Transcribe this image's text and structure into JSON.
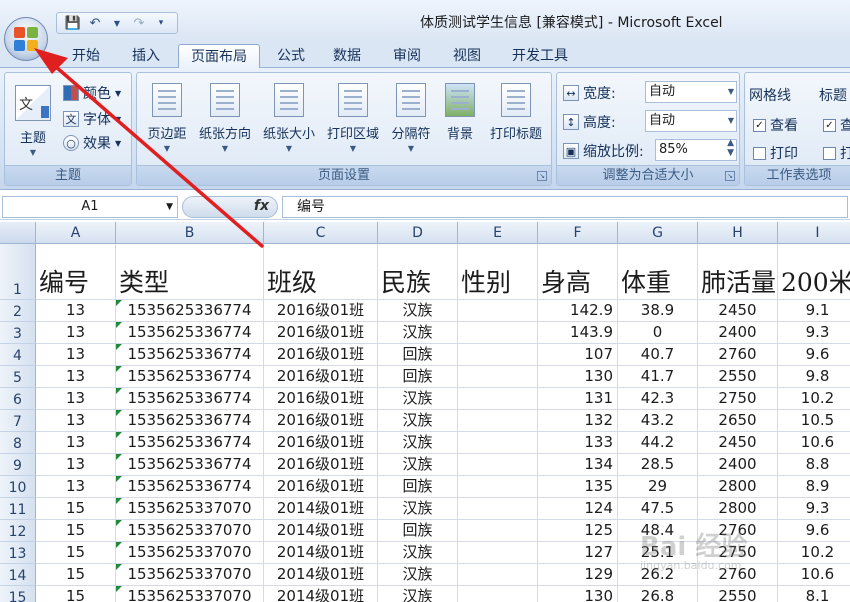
{
  "window": {
    "title": "体质测试学生信息  [兼容模式] - Microsoft Excel"
  },
  "tabs": [
    "开始",
    "插入",
    "页面布局",
    "公式",
    "数据",
    "审阅",
    "视图",
    "开发工具"
  ],
  "active_tab": "页面布局",
  "ribbon": {
    "theme_group": {
      "label": "主题",
      "themes": "主题",
      "colors": "颜色",
      "fonts": "字体",
      "effects": "效果"
    },
    "page_setup_group": {
      "label": "页面设置",
      "buttons": [
        "页边距",
        "纸张方向",
        "纸张大小",
        "打印区域",
        "分隔符",
        "背景",
        "打印标题"
      ]
    },
    "scale_group": {
      "label": "调整为合适大小",
      "width_label": "宽度:",
      "width_value": "自动",
      "height_label": "高度:",
      "height_value": "自动",
      "scale_label": "缩放比例:",
      "scale_value": "85%"
    },
    "sheet_options_group": {
      "label": "工作表选项",
      "gridlines": "网格线",
      "headings": "标题",
      "view": "查看",
      "print": "打印"
    }
  },
  "formula_bar": {
    "name_box": "A1",
    "fx": "fx",
    "content": "编号"
  },
  "columns": [
    "A",
    "B",
    "C",
    "D",
    "E",
    "F",
    "G",
    "H",
    "I"
  ],
  "header_row": [
    "编号",
    "类型",
    "班级",
    "民族",
    "性别",
    "身高",
    "体重",
    "肺活量",
    "200米"
  ],
  "rows": [
    [
      "13",
      "1535625336774",
      "2016级01班",
      "汉族",
      "",
      "142.9",
      "38.9",
      "2450",
      "9.1"
    ],
    [
      "13",
      "1535625336774",
      "2016级01班",
      "汉族",
      "",
      "143.9",
      "0",
      "2400",
      "9.3"
    ],
    [
      "13",
      "1535625336774",
      "2016级01班",
      "回族",
      "",
      "107",
      "40.7",
      "2760",
      "9.6"
    ],
    [
      "13",
      "1535625336774",
      "2016级01班",
      "回族",
      "",
      "130",
      "41.7",
      "2550",
      "9.8"
    ],
    [
      "13",
      "1535625336774",
      "2016级01班",
      "汉族",
      "",
      "131",
      "42.3",
      "2750",
      "10.2"
    ],
    [
      "13",
      "1535625336774",
      "2016级01班",
      "汉族",
      "",
      "132",
      "43.2",
      "2650",
      "10.5"
    ],
    [
      "13",
      "1535625336774",
      "2016级01班",
      "汉族",
      "",
      "133",
      "44.2",
      "2450",
      "10.6"
    ],
    [
      "13",
      "1535625336774",
      "2016级01班",
      "汉族",
      "",
      "134",
      "28.5",
      "2400",
      "8.8"
    ],
    [
      "13",
      "1535625336774",
      "2016级01班",
      "回族",
      "",
      "135",
      "29",
      "2800",
      "8.9"
    ],
    [
      "15",
      "1535625337070",
      "2014级01班",
      "汉族",
      "",
      "124",
      "47.5",
      "2800",
      "9.3"
    ],
    [
      "15",
      "1535625337070",
      "2014级01班",
      "回族",
      "",
      "125",
      "48.4",
      "2760",
      "9.6"
    ],
    [
      "15",
      "1535625337070",
      "2014级01班",
      "汉族",
      "",
      "127",
      "25.1",
      "2750",
      "10.2"
    ],
    [
      "15",
      "1535625337070",
      "2014级01班",
      "汉族",
      "",
      "129",
      "26.2",
      "2760",
      "10.6"
    ],
    [
      "15",
      "1535625337070",
      "2014级01班",
      "汉族",
      "",
      "130",
      "26.8",
      "2550",
      "8.1"
    ]
  ],
  "row_numbers": [
    "1",
    "2",
    "3",
    "4",
    "5",
    "6",
    "7",
    "8",
    "9",
    "10",
    "11",
    "12",
    "13",
    "14",
    "15"
  ],
  "watermark": {
    "main": "Bai 经验",
    "sub": "jingyan.baidu.com"
  },
  "colors": {
    "arrow": "#e02020",
    "ribbon_bg": "#dbe6f4",
    "accent": "#15315a"
  }
}
